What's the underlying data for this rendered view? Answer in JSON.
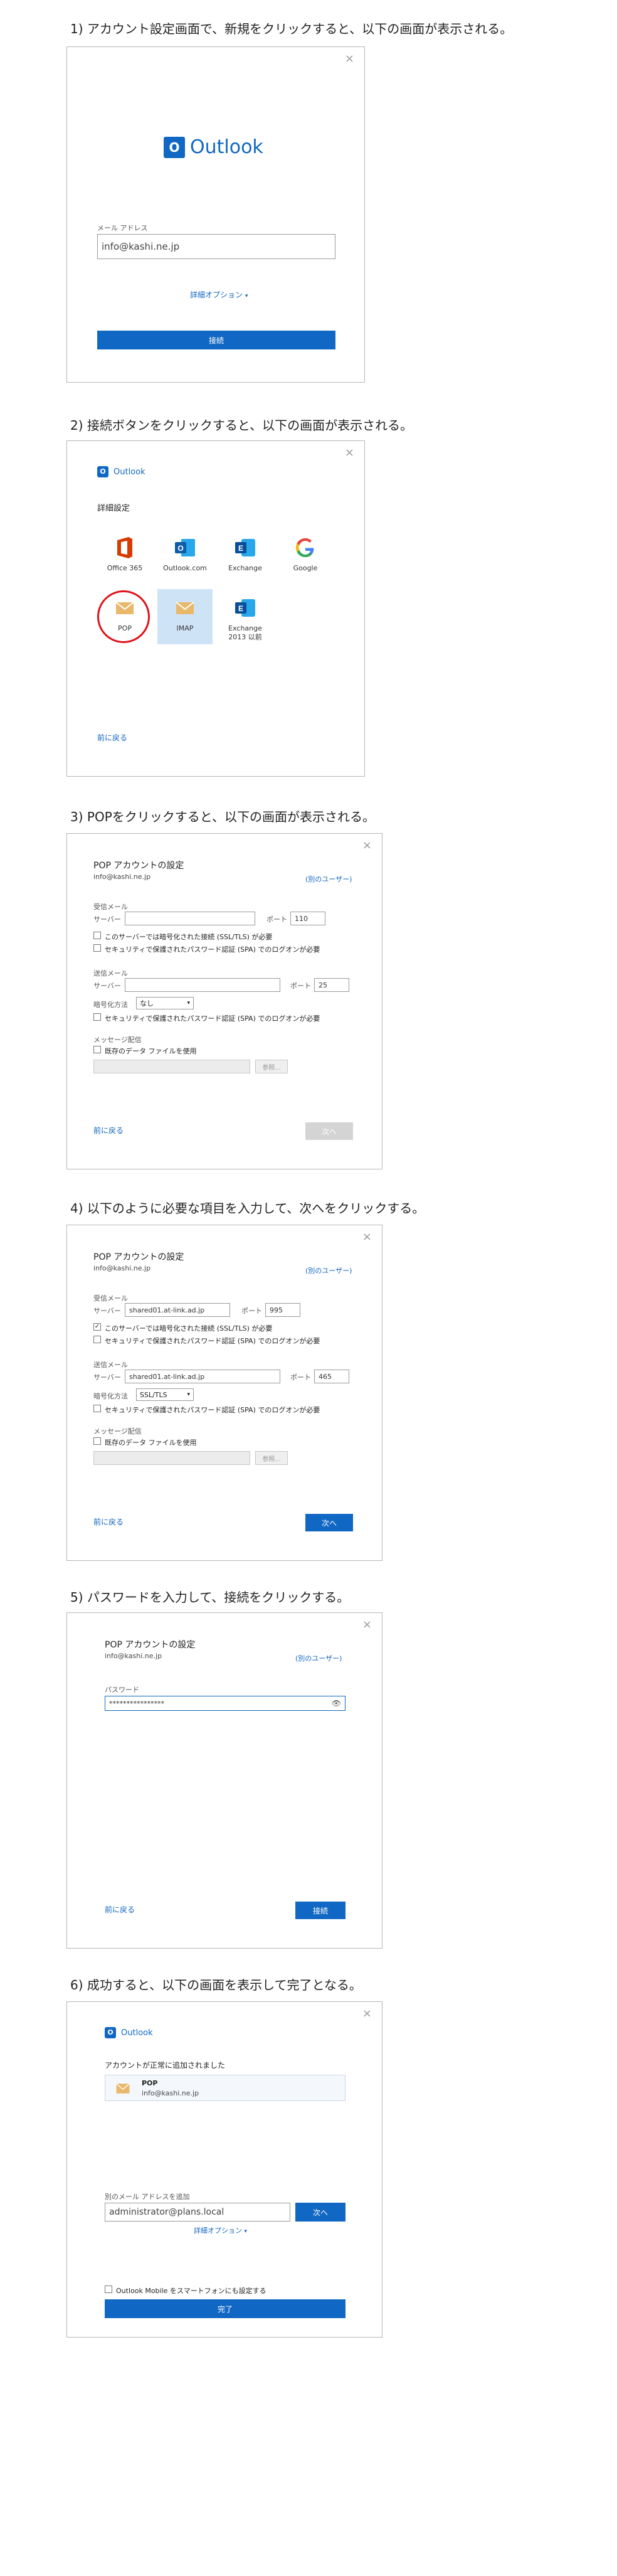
{
  "steps": [
    {
      "title": "1) アカウント設定画面で、新規をクリックすると、以下の画面が表示される。"
    },
    {
      "title": "2) 接続ボタンをクリックすると、以下の画面が表示される。"
    },
    {
      "title": "3) POPをクリックすると、以下の画面が表示される。"
    },
    {
      "title": "4) 以下のように必要な項目を入力して、次へをクリックする。"
    },
    {
      "title": "5) パスワードを入力して、接続をクリックする。"
    },
    {
      "title": "6) 成功すると、以下の画面を表示して完了となる。"
    }
  ],
  "close_glyph": "×",
  "check_glyph": "✓",
  "screen1": {
    "brand": "Outlook",
    "email_label": "メール アドレス",
    "email_value": "info@kashi.ne.jp",
    "advanced_options": "詳細オプション",
    "connect_button": "接続"
  },
  "screen2": {
    "brand": "Outlook",
    "heading": "詳細設定",
    "tiles": [
      {
        "label": "Office 365"
      },
      {
        "label": "Outlook.com"
      },
      {
        "label": "Exchange"
      },
      {
        "label": "Google"
      },
      {
        "label": "POP"
      },
      {
        "label": "IMAP"
      },
      {
        "label": "Exchange\n2013 以前"
      }
    ],
    "back_link": "前に戻る"
  },
  "screen3": {
    "title": "POP アカウントの設定",
    "account": "info@kashi.ne.jp",
    "other_user": "(別のユーザー)",
    "incoming_label": "受信メール",
    "server_label": "サーバー",
    "incoming_server": "",
    "port_label": "ポート",
    "incoming_port": "110",
    "ssl_required": "このサーバーでは暗号化された接続 (SSL/TLS) が必要",
    "spa_required": "セキュリティで保護されたパスワード認証 (SPA) でのログオンが必要",
    "outgoing_label": "送信メール",
    "outgoing_server": "",
    "outgoing_port": "25",
    "encryption_label": "暗号化方法",
    "encryption_value": "なし",
    "spa_required_out": "セキュリティで保護されたパスワード認証 (SPA) でのログオンが必要",
    "delivery_label": "メッセージ配信",
    "existing_file": "既存のデータ ファイルを使用",
    "browse": "参照...",
    "back_link": "前に戻る",
    "next_button": "次へ"
  },
  "screen4": {
    "title": "POP アカウントの設定",
    "account": "info@kashi.ne.jp",
    "other_user": "(別のユーザー)",
    "incoming_label": "受信メール",
    "server_label": "サーバー",
    "incoming_server": "shared01.at-link.ad.jp",
    "port_label": "ポート",
    "incoming_port": "995",
    "ssl_required": "このサーバーでは暗号化された接続 (SSL/TLS) が必要",
    "spa_required": "セキュリティで保護されたパスワード認証 (SPA) でのログオンが必要",
    "outgoing_label": "送信メール",
    "outgoing_server": "shared01.at-link.ad.jp",
    "outgoing_port": "465",
    "encryption_label": "暗号化方法",
    "encryption_value": "SSL/TLS",
    "spa_required_out": "セキュリティで保護されたパスワード認証 (SPA) でのログオンが必要",
    "delivery_label": "メッセージ配信",
    "existing_file": "既存のデータ ファイルを使用",
    "browse": "参照...",
    "back_link": "前に戻る",
    "next_button": "次へ"
  },
  "screen5": {
    "title": "POP アカウントの設定",
    "account": "info@kashi.ne.jp",
    "other_user": "(別のユーザー)",
    "password_label": "パスワード",
    "password_value": "****************",
    "back_link": "前に戻る",
    "connect_button": "接続"
  },
  "screen6": {
    "brand": "Outlook",
    "success_message": "アカウントが正常に追加されました",
    "account_type": "POP",
    "account_email": "info@kashi.ne.jp",
    "add_label": "別のメール アドレスを追加",
    "add_value": "administrator@plans.local",
    "next_button": "次へ",
    "advanced_options": "詳細オプション",
    "mobile_setup": "Outlook Mobile をスマートフォンにも設定する",
    "done_button": "完了"
  },
  "colors": {
    "accent": "#1168c4",
    "pop_circle": "#e0121a",
    "tile_selected": "#cfe3f6"
  }
}
